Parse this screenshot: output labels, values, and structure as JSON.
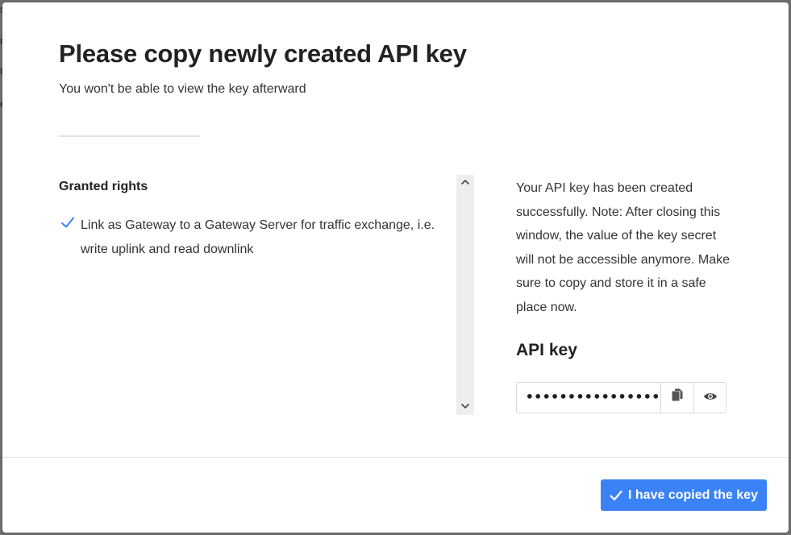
{
  "backdrop": {
    "fragments": [
      "s",
      "r",
      "r",
      "e"
    ]
  },
  "modal": {
    "title": "Please copy newly created API key",
    "subtitle": "You won't be able to view the key afterward"
  },
  "rights": {
    "heading": "Granted rights",
    "items": [
      {
        "label": "Link as Gateway to a Gateway Server for traffic exchange, i.e. write uplink and read downlink",
        "icon": "check-icon"
      }
    ]
  },
  "info": {
    "text": "Your API key has been created successfully. Note: After closing this window, the value of the key secret will not be accessible anymore. Make sure to copy and store it in a safe place now."
  },
  "api_key": {
    "heading": "API key",
    "masked_value": "••••••••••••••••••••",
    "copy_icon": "copy-icon",
    "show_icon": "eye-icon"
  },
  "footer": {
    "confirm_label": "I have copied the key",
    "confirm_icon": "check-icon"
  },
  "colors": {
    "primary": "#3b82f6",
    "check": "#3b82f6",
    "scrollbar": "#eeeeee"
  }
}
